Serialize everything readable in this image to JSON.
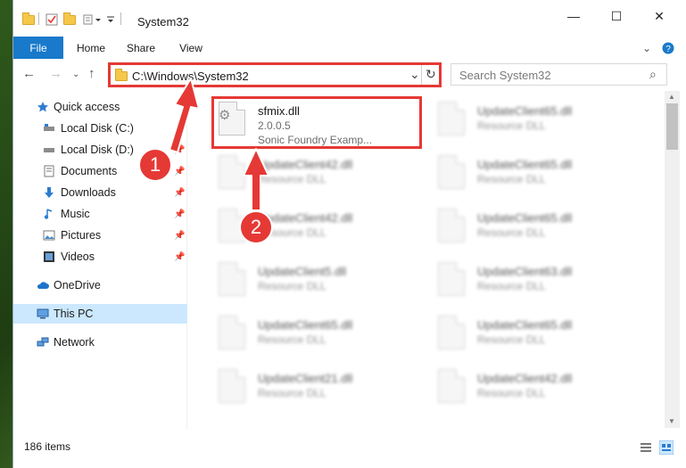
{
  "window": {
    "title": "System32",
    "minimize_icon": "—",
    "maximize_icon": "☐",
    "close_icon": "✕"
  },
  "ribbon": {
    "tabs": [
      "File",
      "Home",
      "Share",
      "View"
    ]
  },
  "address": {
    "path": "C:\\Windows\\System32",
    "refresh_icon": "↻",
    "dropdown_icon": "⌄"
  },
  "search": {
    "placeholder": "Search System32",
    "icon": "⌕"
  },
  "sidebar": {
    "items": [
      {
        "label": "Quick access",
        "icon": "star-icon"
      },
      {
        "label": "Local Disk (C:)",
        "icon": "drive-icon",
        "pinned": true
      },
      {
        "label": "Local Disk (D:)",
        "icon": "drive-icon",
        "pinned": true
      },
      {
        "label": "Documents",
        "icon": "documents-icon",
        "pinned": true
      },
      {
        "label": "Downloads",
        "icon": "downloads-icon",
        "pinned": true
      },
      {
        "label": "Music",
        "icon": "music-icon",
        "pinned": true
      },
      {
        "label": "Pictures",
        "icon": "pictures-icon",
        "pinned": true
      },
      {
        "label": "Videos",
        "icon": "videos-icon",
        "pinned": true
      },
      {
        "label": "OneDrive",
        "icon": "cloud-icon"
      },
      {
        "label": "This PC",
        "icon": "pc-icon",
        "selected": true
      },
      {
        "label": "Network",
        "icon": "network-icon"
      }
    ]
  },
  "files": [
    {
      "name": "sfmix.dll",
      "version": "2.0.0.5",
      "desc": "Sonic Foundry Examp...",
      "highlighted": true
    },
    {
      "name": "UpdateClient65.dll",
      "type": "Resource DLL"
    },
    {
      "name": "UpdateClient42.dll",
      "type": "Resource DLL"
    },
    {
      "name": "UpdateClient65.dll",
      "type": "Resource DLL"
    },
    {
      "name": "UpdateClient42.dll",
      "type": "Resource DLL"
    },
    {
      "name": "UpdateClient65.dll",
      "type": "Resource DLL"
    },
    {
      "name": "UpdateClient5.dll",
      "type": "Resource DLL"
    },
    {
      "name": "UpdateClient63.dll",
      "type": "Resource DLL"
    },
    {
      "name": "UpdateClient65.dll",
      "type": "Resource DLL"
    },
    {
      "name": "UpdateClient65.dll",
      "type": "Resource DLL"
    },
    {
      "name": "UpdateClient21.dll",
      "type": "Resource DLL"
    },
    {
      "name": "UpdateClient42.dll",
      "type": "Resource DLL"
    }
  ],
  "status": {
    "item_count": "186 items"
  },
  "annotations": {
    "step1": "1",
    "step2": "2",
    "color": "#e53935"
  }
}
